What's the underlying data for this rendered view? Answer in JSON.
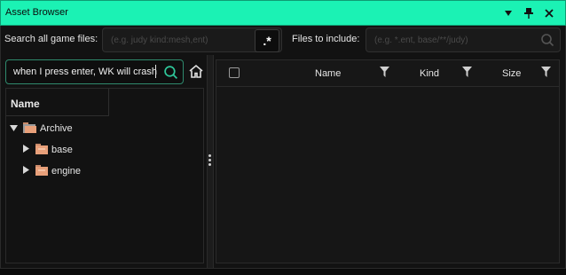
{
  "window": {
    "title": "Asset Browser",
    "controls": [
      "chevron-down-icon",
      "pin-icon",
      "close-icon"
    ]
  },
  "search": {
    "label": "Search all game files:",
    "placeholder": "(e.g. judy kind:mesh,ent)",
    "regex_label": ".*"
  },
  "include": {
    "label": "Files to include:",
    "placeholder": "(e.g. *.ent, base/**/judy)"
  },
  "tree_search": {
    "value": "when I press enter, WK will crash"
  },
  "tree": {
    "header": "Name",
    "items": [
      {
        "label": "Archive",
        "expanded": true,
        "icon": "folder-open-icon"
      },
      {
        "label": "base",
        "expanded": false,
        "icon": "folder-icon"
      },
      {
        "label": "engine",
        "expanded": false,
        "icon": "folder-icon"
      }
    ]
  },
  "table": {
    "columns": [
      {
        "label": "Name"
      },
      {
        "label": "Kind"
      },
      {
        "label": "Size"
      }
    ],
    "rows": []
  },
  "colors": {
    "accent": "#1bf2b4",
    "folder": "#e8a07a",
    "search_border": "#2f8a6d"
  }
}
